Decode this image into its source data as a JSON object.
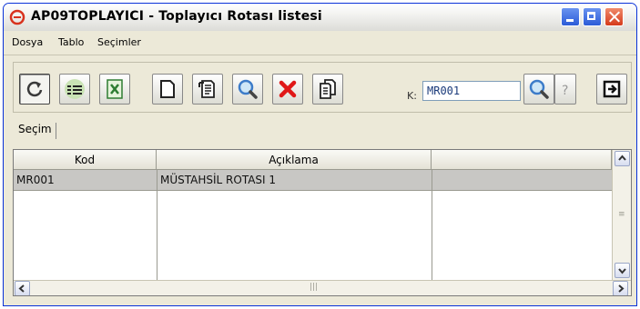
{
  "window": {
    "title": "AP09TOPLAYICI - Toplayıcı Rotası listesi"
  },
  "menu": {
    "items": [
      "Dosya",
      "Tablo",
      "Seçimler"
    ]
  },
  "toolbar": {
    "buttons": [
      {
        "name": "refresh-icon",
        "pressed": true
      },
      {
        "name": "list-view-icon"
      },
      {
        "name": "excel-export-icon"
      },
      {
        "name": "new-document-icon"
      },
      {
        "name": "edit-document-icon"
      },
      {
        "name": "search-icon"
      },
      {
        "name": "delete-icon"
      },
      {
        "name": "copy-documents-icon"
      },
      {
        "name": "find-icon"
      },
      {
        "name": "help-icon"
      },
      {
        "name": "exit-icon"
      }
    ],
    "k_label": "K:",
    "k_value": "MR001"
  },
  "tabs": {
    "selection": "Seçim"
  },
  "grid": {
    "columns": [
      "Kod",
      "Açıklama",
      ""
    ],
    "rows": [
      {
        "kod": "MR001",
        "aciklama": "MÜSTAHSİL ROTASI 1"
      }
    ]
  },
  "colors": {
    "window_border": "#0831d9",
    "selected_row": "#c8c7c4",
    "close_button": "#d53b1c",
    "title_buttons": "#2b5bd7"
  }
}
